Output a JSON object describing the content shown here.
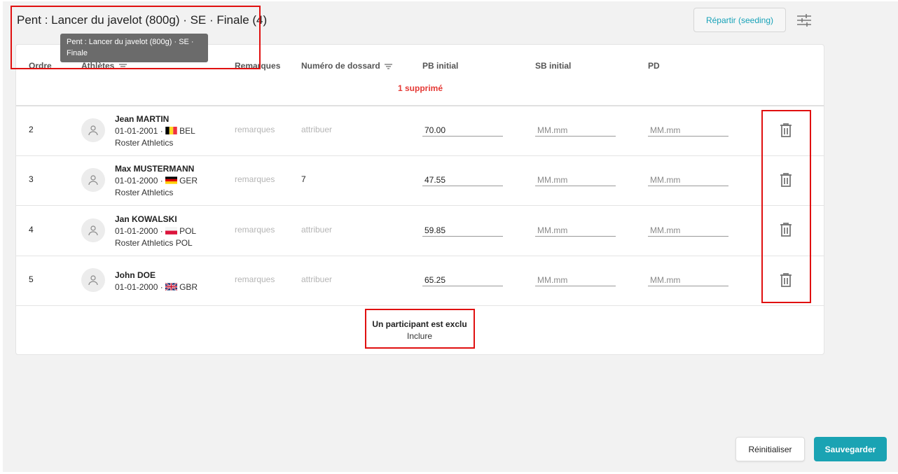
{
  "header": {
    "title": "Pent : Lancer du javelot (800g) · SE · Finale (4)",
    "tooltip": "Pent : Lancer du javelot (800g) · SE · Finale",
    "seeding_label": "Répartir (seeding)"
  },
  "columns": {
    "order": "Ordre",
    "athletes": "Athlètes",
    "remarks": "Remarques",
    "bib": "Numéro de dossard",
    "pb": "PB initial",
    "sb": "SB initial",
    "pd": "PD"
  },
  "deleted_notice": "1 supprimé",
  "placeholders": {
    "remarks": "remarques",
    "bib": "attribuer",
    "mark": "MM.mm"
  },
  "rows": [
    {
      "order": "2",
      "name": "Jean MARTIN",
      "dob": "01-01-2001 ·",
      "country": "BEL",
      "club": "Roster Athletics",
      "remarks": "remarques",
      "bib": "attribuer",
      "pb": "70.00"
    },
    {
      "order": "3",
      "name": "Max MUSTERMANN",
      "dob": "01-01-2000 ·",
      "country": "GER",
      "club": "Roster Athletics",
      "remarks": "remarques",
      "bib": "7",
      "pb": "47.55"
    },
    {
      "order": "4",
      "name": "Jan KOWALSKI",
      "dob": "01-01-2000 ·",
      "country": "POL",
      "club": "Roster Athletics POL",
      "remarks": "remarques",
      "bib": "attribuer",
      "pb": "59.85"
    },
    {
      "order": "5",
      "name": "John DOE",
      "dob": "01-01-2000 ·",
      "country": "GBR",
      "club": "",
      "remarks": "remarques",
      "bib": "attribuer",
      "pb": "65.25"
    }
  ],
  "excluded": {
    "message": "Un participant est exclu",
    "include_label": "Inclure"
  },
  "footer": {
    "reset_label": "Réinitialiser",
    "save_label": "Sauvegarder"
  },
  "colors": {
    "accent": "#1aa3b3",
    "deleted": "#e53935",
    "annotation": "#e01010"
  }
}
